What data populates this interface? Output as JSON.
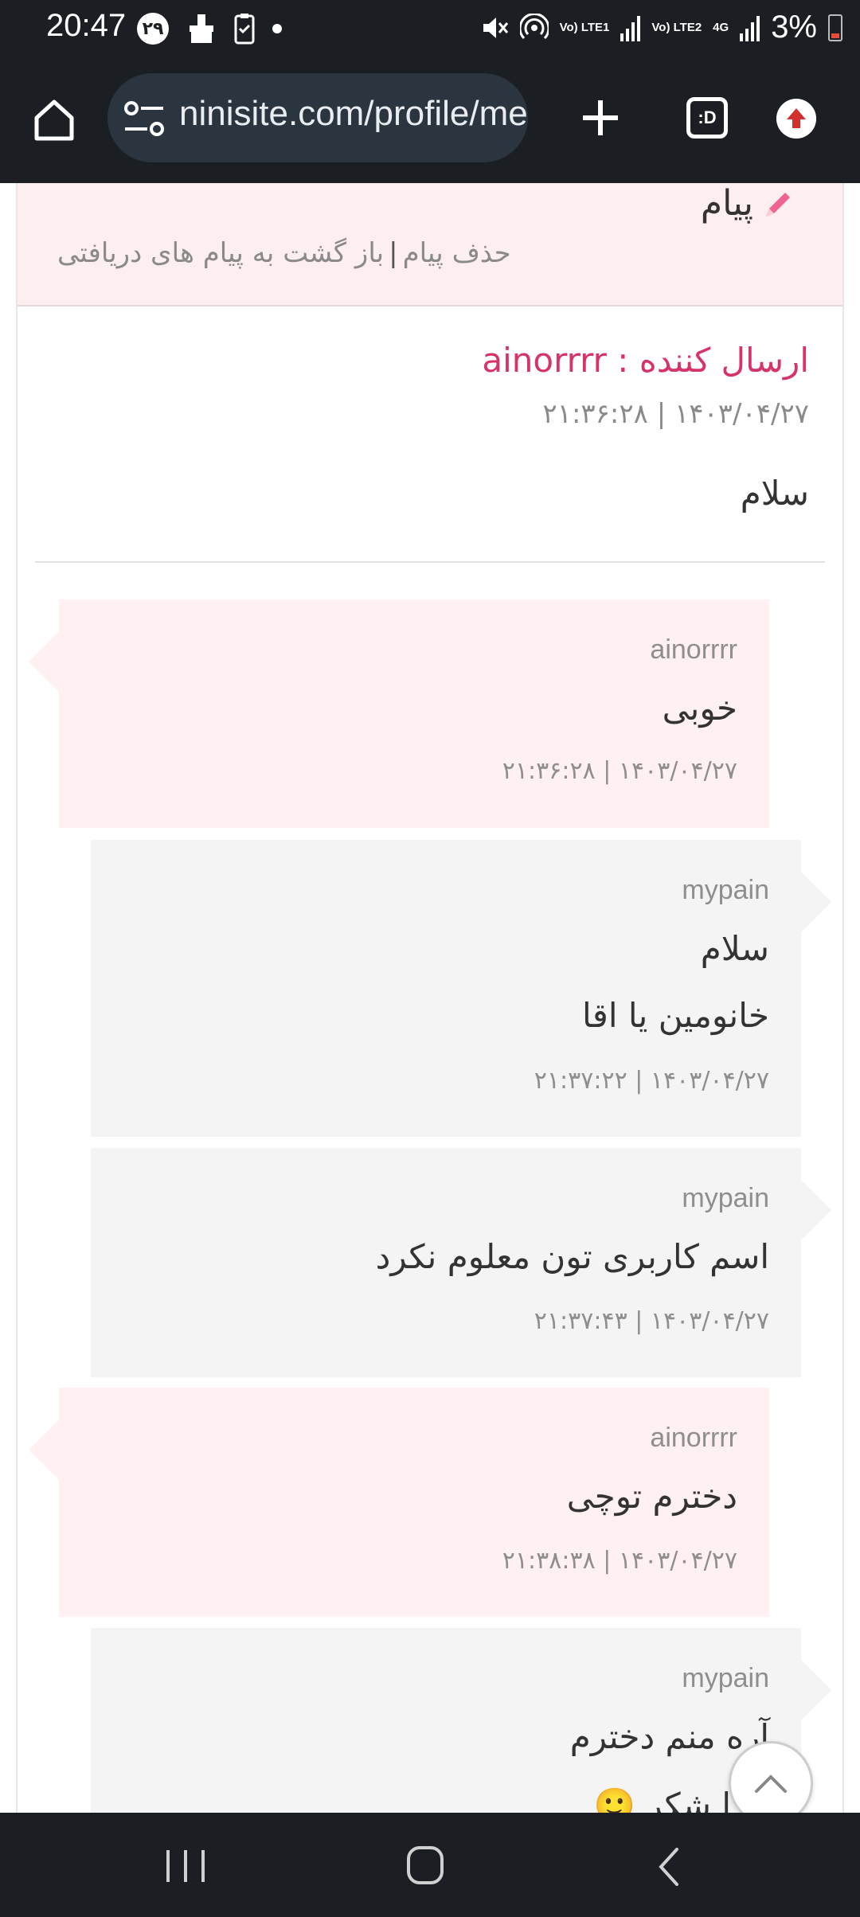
{
  "status_bar": {
    "time": "20:47",
    "badge": "۲۹",
    "battery_percent": "3%",
    "sim1_label": "Vo) LTE1",
    "sim2_label": "Vo) LTE2",
    "network_type": "4G"
  },
  "browser": {
    "url": "ninisite.com/profile/message",
    "tab_switcher_label": ":D"
  },
  "message_page": {
    "title": "پیام",
    "delete_link": "حذف پیام",
    "separator": "|",
    "back_link": "باز گشت به پیام های دریافتی",
    "sender_line": "ارسال کننده : ainorrrr",
    "sent_date": "۱۴۰۳/۰۴/۲۷ | ۲۱:۳۶:۲۸",
    "body": "سلام"
  },
  "conversation": [
    {
      "user": "ainorrrr",
      "lines": [
        "خوبی"
      ],
      "timestamp": "۱۴۰۳/۰۴/۲۷ | ۲۱:۳۶:۲۸"
    },
    {
      "user": "mypain",
      "lines": [
        "سلام",
        "خانومین یا اقا"
      ],
      "timestamp": "۱۴۰۳/۰۴/۲۷ | ۲۱:۳۷:۲۲"
    },
    {
      "user": "mypain",
      "lines": [
        "اسم کاربری تون معلوم نکرد"
      ],
      "timestamp": "۱۴۰۳/۰۴/۲۷ | ۲۱:۳۷:۴۳"
    },
    {
      "user": "ainorrrr",
      "lines": [
        "دخترم توچی"
      ],
      "timestamp": "۱۴۰۳/۰۴/۲۷ | ۲۱:۳۸:۳۸"
    },
    {
      "user": "mypain",
      "lines": [
        "آره منم دخترم",
        "خدا شکر 🙂"
      ],
      "timestamp": ""
    }
  ],
  "colors": {
    "accent_pink": "#d6336c",
    "bubble_pink": "#fff0f1",
    "bubble_grey": "#f4f4f4",
    "header_bg": "#fdeef0",
    "system_bar": "#1b1f23"
  },
  "icons": {
    "home": "home-icon",
    "site_settings": "tune-icon",
    "new_tab": "plus-icon",
    "update": "update-arrow-icon",
    "edit": "pencil-icon",
    "scroll_top": "chevron-up-icon"
  }
}
